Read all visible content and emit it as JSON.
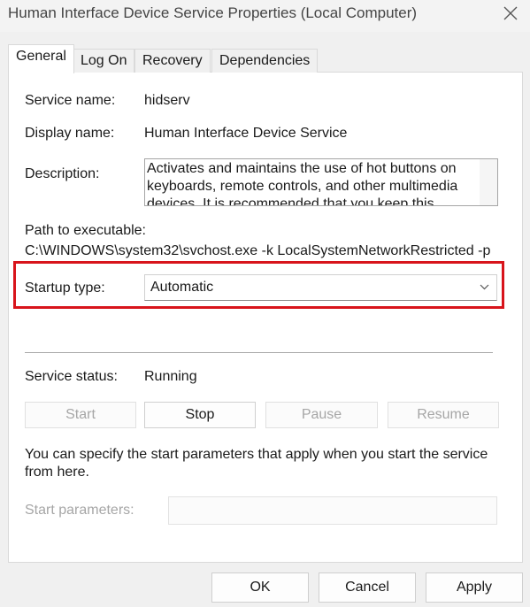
{
  "window": {
    "title": "Human Interface Device Service Properties (Local Computer)"
  },
  "tabs": [
    {
      "label": "General"
    },
    {
      "label": "Log On"
    },
    {
      "label": "Recovery"
    },
    {
      "label": "Dependencies"
    }
  ],
  "general": {
    "service_name_label": "Service name:",
    "service_name_value": "hidserv",
    "display_name_label": "Display name:",
    "display_name_value": "Human Interface Device Service",
    "description_label": "Description:",
    "description_value": "Activates and maintains the use of hot buttons on keyboards, remote controls, and other multimedia devices. It is recommended that you keep this",
    "path_label": "Path to executable:",
    "path_value": "C:\\WINDOWS\\system32\\svchost.exe -k LocalSystemNetworkRestricted -p",
    "startup_type_label": "Startup type:",
    "startup_type_value": "Automatic",
    "service_status_label": "Service status:",
    "service_status_value": "Running",
    "buttons": {
      "start": "Start",
      "stop": "Stop",
      "pause": "Pause",
      "resume": "Resume"
    },
    "hint_text": "You can specify the start parameters that apply when you start the service from here.",
    "start_params_label": "Start parameters:",
    "start_params_value": ""
  },
  "footer": {
    "ok": "OK",
    "cancel": "Cancel",
    "apply": "Apply"
  },
  "colors": {
    "highlight": "#d8141b",
    "panel": "#ffffff",
    "window": "#f0f0f0"
  },
  "icons": {
    "close": "close-icon",
    "dropdown": "chevron-down-icon"
  }
}
